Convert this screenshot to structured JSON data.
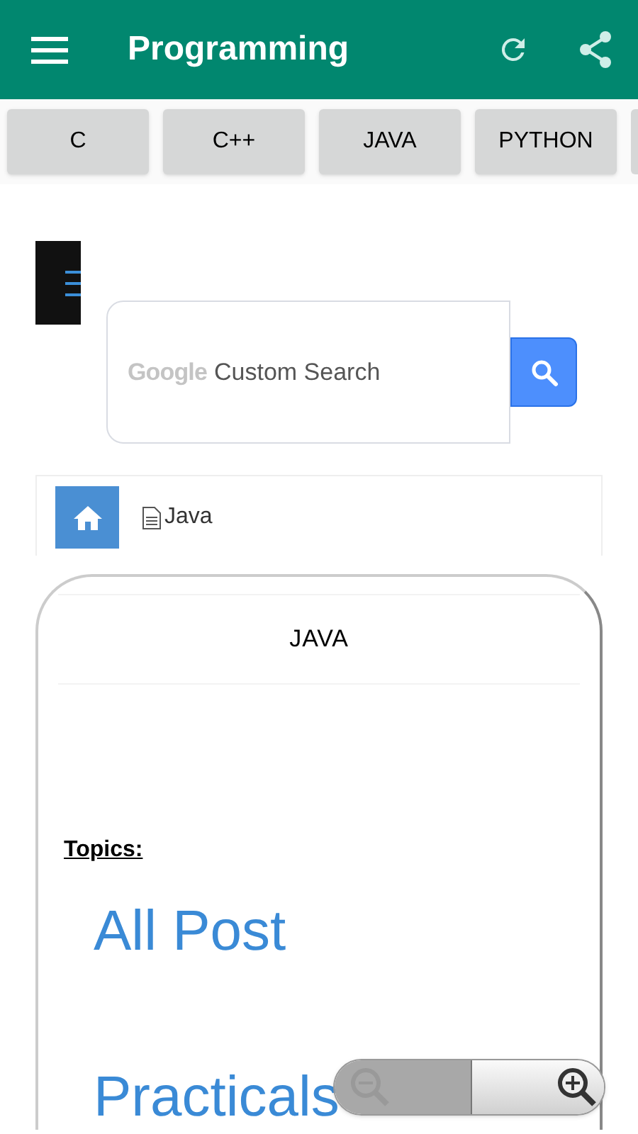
{
  "app_bar": {
    "title": "Programming"
  },
  "tabs": [
    {
      "label": "C"
    },
    {
      "label": "C++"
    },
    {
      "label": "JAVA"
    },
    {
      "label": "PYTHON"
    }
  ],
  "search": {
    "logo": "Google",
    "placeholder": "Custom Search"
  },
  "breadcrumb": {
    "current": "Java"
  },
  "card": {
    "heading": "JAVA",
    "topics_label": "Topics:",
    "links": [
      "All Post",
      "Practicals"
    ]
  },
  "zoom_controls": {
    "zoom_out_disabled": true,
    "zoom_in_disabled": false
  }
}
